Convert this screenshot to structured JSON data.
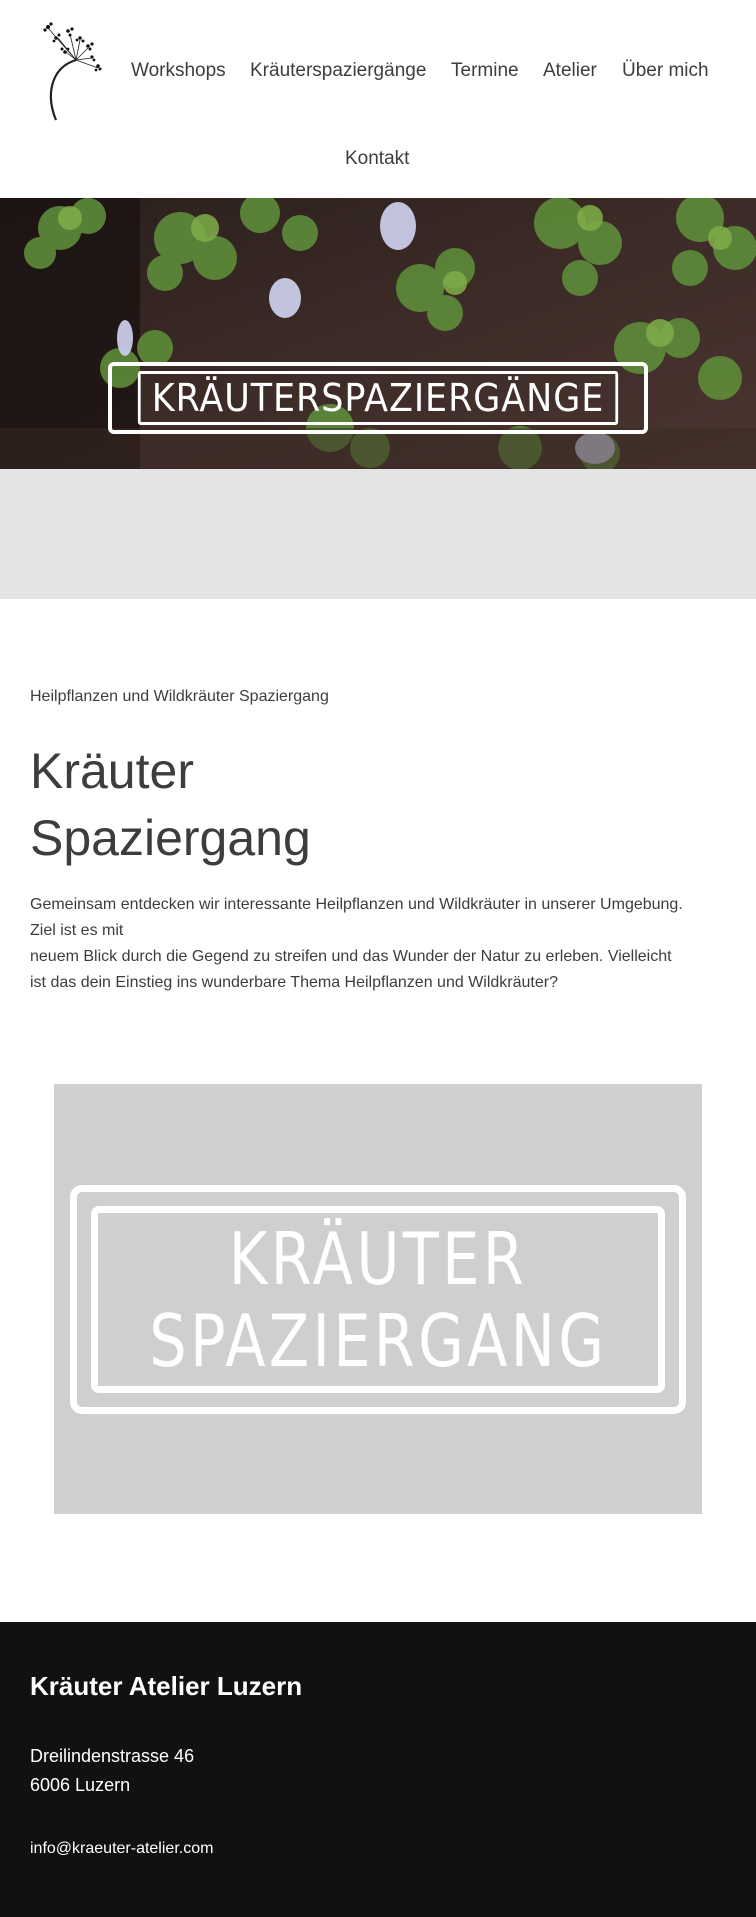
{
  "nav": {
    "items": [
      {
        "label": "Workshops"
      },
      {
        "label": "Kräuterspaziergänge"
      },
      {
        "label": "Termine"
      },
      {
        "label": "Atelier"
      },
      {
        "label": "Über mich"
      },
      {
        "label": "Kontakt"
      }
    ]
  },
  "hero": {
    "banner_text": "KRÄUTERSPAZIERGÄNGE"
  },
  "intro": {
    "eyebrow": "Heilpflanzen und Wildkräuter Spaziergang",
    "headline_line1": "Kräuter",
    "headline_line2": "Spaziergang",
    "body_line1": "Gemeinsam entdecken wir interessante Heilpflanzen und Wildkräuter in unserer Umgebung.",
    "body_line2": "Ziel ist es mit",
    "body_line3": "neuem Blick durch die Gegend zu streifen und das Wunder der Natur zu erleben. Vielleicht",
    "body_line4": "ist das dein Einstieg ins wunderbare Thema Heilpflanzen und Wildkräuter?"
  },
  "feature": {
    "line1": "KRÄUTER",
    "line2": "SPAZIERGANG"
  },
  "footer": {
    "title": "Kräuter Atelier Luzern",
    "street": "Dreilindenstrasse 46",
    "city": "6006 Luzern",
    "email": "info@kraeuter-atelier.com"
  },
  "colors": {
    "text": "#3d3d3d",
    "grey_band": "#e4e4e4",
    "feature_bg": "#cfcfcf",
    "footer_bg": "#111111"
  },
  "icons": {
    "logo": "dandelion-stem-logo"
  }
}
